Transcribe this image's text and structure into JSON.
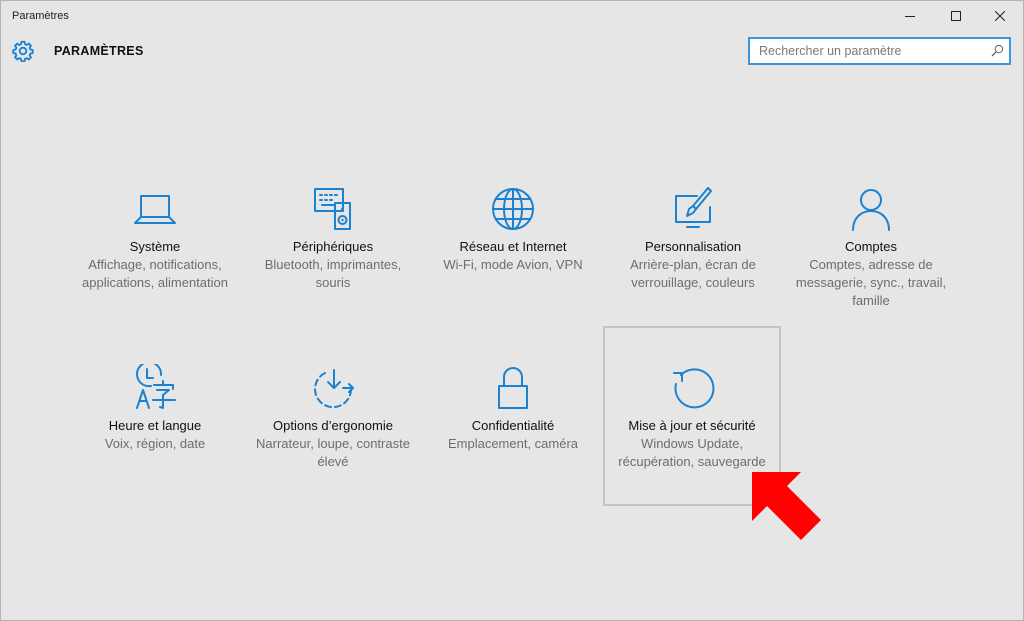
{
  "window": {
    "title": "Paramètres",
    "controls": [
      "minimize",
      "maximize",
      "close"
    ]
  },
  "header": {
    "title": "PARAMÈTRES",
    "icon": "gear-icon"
  },
  "search": {
    "placeholder": "Rechercher un paramètre",
    "value": "",
    "icon": "search-icon"
  },
  "accent_color": "#1b82d1",
  "annotation": {
    "icon": "red-arrow-icon",
    "color": "#ff0000",
    "points_to": "Mise à jour et sécurité"
  },
  "tiles": [
    {
      "label": "Système",
      "desc": "Affichage, notifications, applications, alimentation",
      "icon": "laptop-icon"
    },
    {
      "label": "Périphériques",
      "desc": "Bluetooth, imprimantes, souris",
      "icon": "keyboard-speaker-icon"
    },
    {
      "label": "Réseau et Internet",
      "desc": "Wi-Fi, mode Avion, VPN",
      "icon": "globe-icon"
    },
    {
      "label": "Personnalisation",
      "desc": "Arrière-plan, écran de verrouillage, couleurs",
      "icon": "paintbrush-monitor-icon"
    },
    {
      "label": "Comptes",
      "desc": "Comptes, adresse de messagerie, sync., travail, famille",
      "icon": "person-icon"
    },
    {
      "label": "Heure et langue",
      "desc": "Voix, région, date",
      "icon": "clock-language-icon"
    },
    {
      "label": "Options d’ergonomie",
      "desc": "Narrateur, loupe, contraste élevé",
      "icon": "accessibility-timer-icon"
    },
    {
      "label": "Confidentialité",
      "desc": "Emplacement, caméra",
      "icon": "padlock-icon"
    },
    {
      "label": "Mise à jour et sécurité",
      "desc": "Windows Update, récupération, sauvegarde",
      "icon": "refresh-icon",
      "selected": true
    }
  ]
}
